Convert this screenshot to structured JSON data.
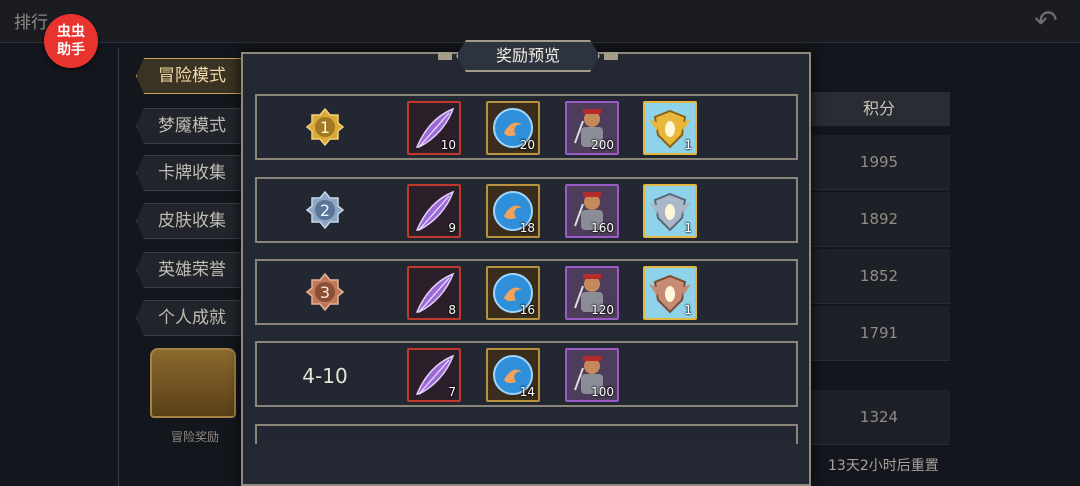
{
  "header": {
    "title": "排行",
    "helper_badge": "虫虫\n助手"
  },
  "sidebar": {
    "tabs": [
      "冒险模式",
      "梦魇模式",
      "卡牌收集",
      "皮肤收集",
      "英雄荣誉",
      "个人成就"
    ],
    "active_tab": "冒险模式",
    "chest_label": "冒险奖励"
  },
  "scores": {
    "header": "积分",
    "values": [
      "1995",
      "1892",
      "1852",
      "1791",
      "1324"
    ],
    "reset_text": "13天2小时后重置"
  },
  "modal": {
    "title": "奖励预览",
    "rows": [
      {
        "rank": "1",
        "rank_color": "#d9a93a",
        "items": [
          {
            "icon": "purple-feather-icon",
            "qty": "10"
          },
          {
            "icon": "blue-orb-icon",
            "qty": "20"
          },
          {
            "icon": "hero-card-icon",
            "qty": "200"
          },
          {
            "icon": "gold-shield-icon",
            "qty": "1"
          }
        ]
      },
      {
        "rank": "2",
        "rank_color": "#8da6c4",
        "items": [
          {
            "icon": "purple-feather-icon",
            "qty": "9"
          },
          {
            "icon": "blue-orb-icon",
            "qty": "18"
          },
          {
            "icon": "hero-card-icon",
            "qty": "160"
          },
          {
            "icon": "silver-shield-icon",
            "qty": "1"
          }
        ]
      },
      {
        "rank": "3",
        "rank_color": "#c07a5a",
        "items": [
          {
            "icon": "purple-feather-icon",
            "qty": "8"
          },
          {
            "icon": "blue-orb-icon",
            "qty": "16"
          },
          {
            "icon": "hero-card-icon",
            "qty": "120"
          },
          {
            "icon": "bronze-shield-icon",
            "qty": "1"
          }
        ]
      },
      {
        "rank": "4-10",
        "items": [
          {
            "icon": "purple-feather-icon",
            "qty": "7"
          },
          {
            "icon": "blue-orb-icon",
            "qty": "14"
          },
          {
            "icon": "hero-card-icon",
            "qty": "100"
          }
        ]
      }
    ]
  }
}
